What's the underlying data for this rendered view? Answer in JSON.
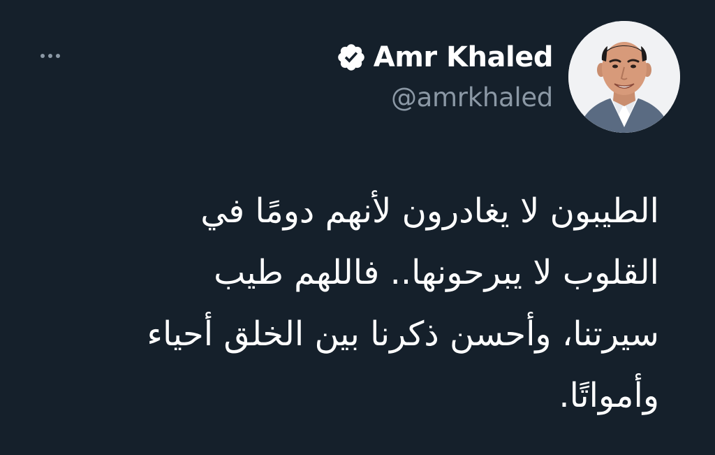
{
  "colors": {
    "background": "#15202b",
    "primary_text": "#ffffff",
    "secondary_text": "#8b98a5",
    "verified_badge": "#ffffff"
  },
  "tweet": {
    "author": {
      "display_name": "Amr Khaled",
      "handle": "@amrkhaled",
      "verified": true,
      "verified_icon": "verified-badge-icon",
      "avatar_icon": "profile-photo"
    },
    "more_icon": "more-options-icon",
    "text_lines": [
      "الطيبون لا يغادرون لأنهم دومًا في",
      "القلوب لا يبرحونها.. فاللهم طيب",
      "سيرتنا، وأحسن ذكرنا بين الخلق أحياء",
      "وأمواتًا."
    ]
  }
}
